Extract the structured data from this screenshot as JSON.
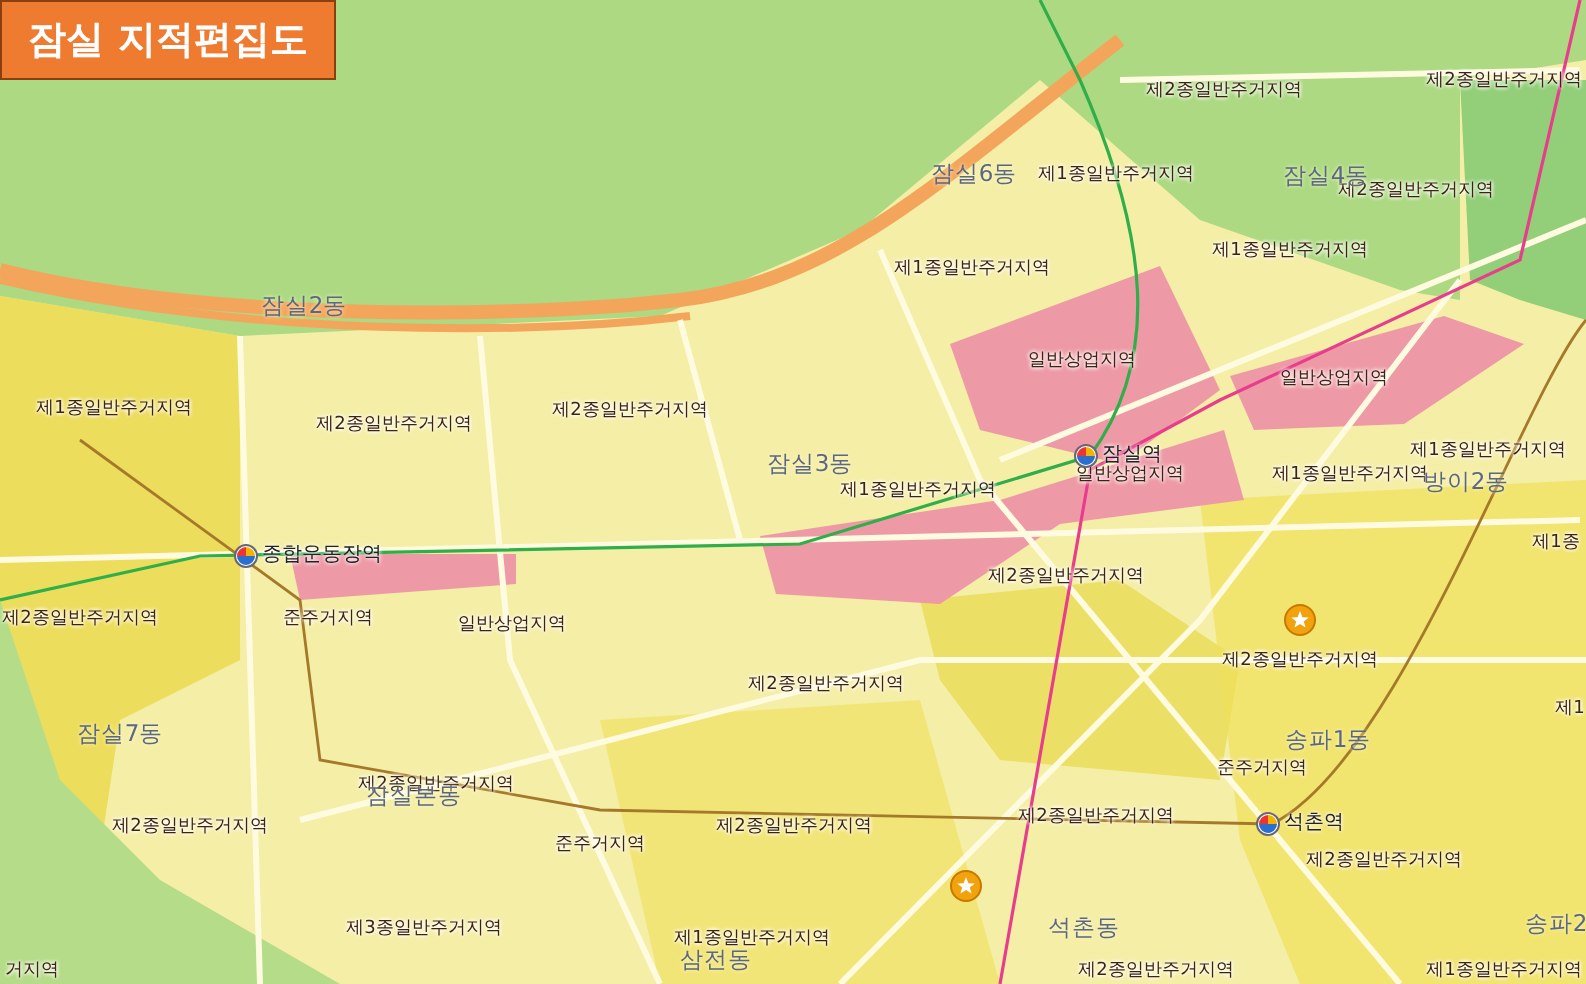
{
  "title": "잠실 지적편집도",
  "labels": [
    {
      "kind": "zone",
      "text": "제2종일반주거지역"
    },
    {
      "kind": "zone",
      "text": "제2종일반주거지역"
    },
    {
      "kind": "zone",
      "text": "제1종일반주거지역"
    },
    {
      "kind": "zone",
      "text": "제2종일반주거지역"
    },
    {
      "kind": "zone",
      "text": "제1종일반주거지역"
    },
    {
      "kind": "zone",
      "text": "제1종일반주거지역"
    },
    {
      "kind": "zone",
      "text": "일반상업지역"
    },
    {
      "kind": "zone",
      "text": "일반상업지역"
    },
    {
      "kind": "zone",
      "text": "제1종일반주거지역"
    },
    {
      "kind": "zone",
      "text": "제2종일반주거지역"
    },
    {
      "kind": "zone",
      "text": "제2종일반주거지역"
    },
    {
      "kind": "zone",
      "text": "제1종일반주거지역"
    },
    {
      "kind": "zone",
      "text": "제1종일반주거지역"
    },
    {
      "kind": "zone",
      "text": "일반상업지역"
    },
    {
      "kind": "zone",
      "text": "제1종일반주거지역"
    },
    {
      "kind": "zone",
      "text": "제1종"
    },
    {
      "kind": "zone",
      "text": "제2종일반주거지역"
    },
    {
      "kind": "zone",
      "text": "제2종일반주거지역"
    },
    {
      "kind": "zone",
      "text": "준주거지역"
    },
    {
      "kind": "zone",
      "text": "일반상업지역"
    },
    {
      "kind": "zone",
      "text": "제2종일반주거지역"
    },
    {
      "kind": "zone",
      "text": "제2종일반주거지역"
    },
    {
      "kind": "zone",
      "text": "제1"
    },
    {
      "kind": "zone",
      "text": "준주거지역"
    },
    {
      "kind": "zone",
      "text": "제2종일반주거지역"
    },
    {
      "kind": "zone",
      "text": "제2종일반주거지역"
    },
    {
      "kind": "zone",
      "text": "제2종일반주거지역"
    },
    {
      "kind": "zone",
      "text": "제2종일반주거지역"
    },
    {
      "kind": "zone",
      "text": "준주거지역"
    },
    {
      "kind": "zone",
      "text": "제2종일반주거지역"
    },
    {
      "kind": "zone",
      "text": "제3종일반주거지역"
    },
    {
      "kind": "zone",
      "text": "제1종일반주거지역"
    },
    {
      "kind": "zone",
      "text": "거지역"
    },
    {
      "kind": "zone",
      "text": "제2종일반주거지역"
    },
    {
      "kind": "zone",
      "text": "제1종일반주거지역"
    },
    {
      "kind": "district",
      "text": "잠실2동"
    },
    {
      "kind": "district",
      "text": "잠실6동"
    },
    {
      "kind": "district",
      "text": "잠실4동"
    },
    {
      "kind": "district",
      "text": "잠실3동"
    },
    {
      "kind": "district",
      "text": "방이2동"
    },
    {
      "kind": "district",
      "text": "잠실7동"
    },
    {
      "kind": "district",
      "text": "잠실본동"
    },
    {
      "kind": "district",
      "text": "송파1동"
    },
    {
      "kind": "district",
      "text": "석촌동"
    },
    {
      "kind": "district",
      "text": "삼전동"
    },
    {
      "kind": "district",
      "text": "송파2"
    },
    {
      "kind": "station",
      "text": "잠실역"
    },
    {
      "kind": "station",
      "text": "종합운동장역"
    },
    {
      "kind": "station",
      "text": "석촌역"
    }
  ]
}
